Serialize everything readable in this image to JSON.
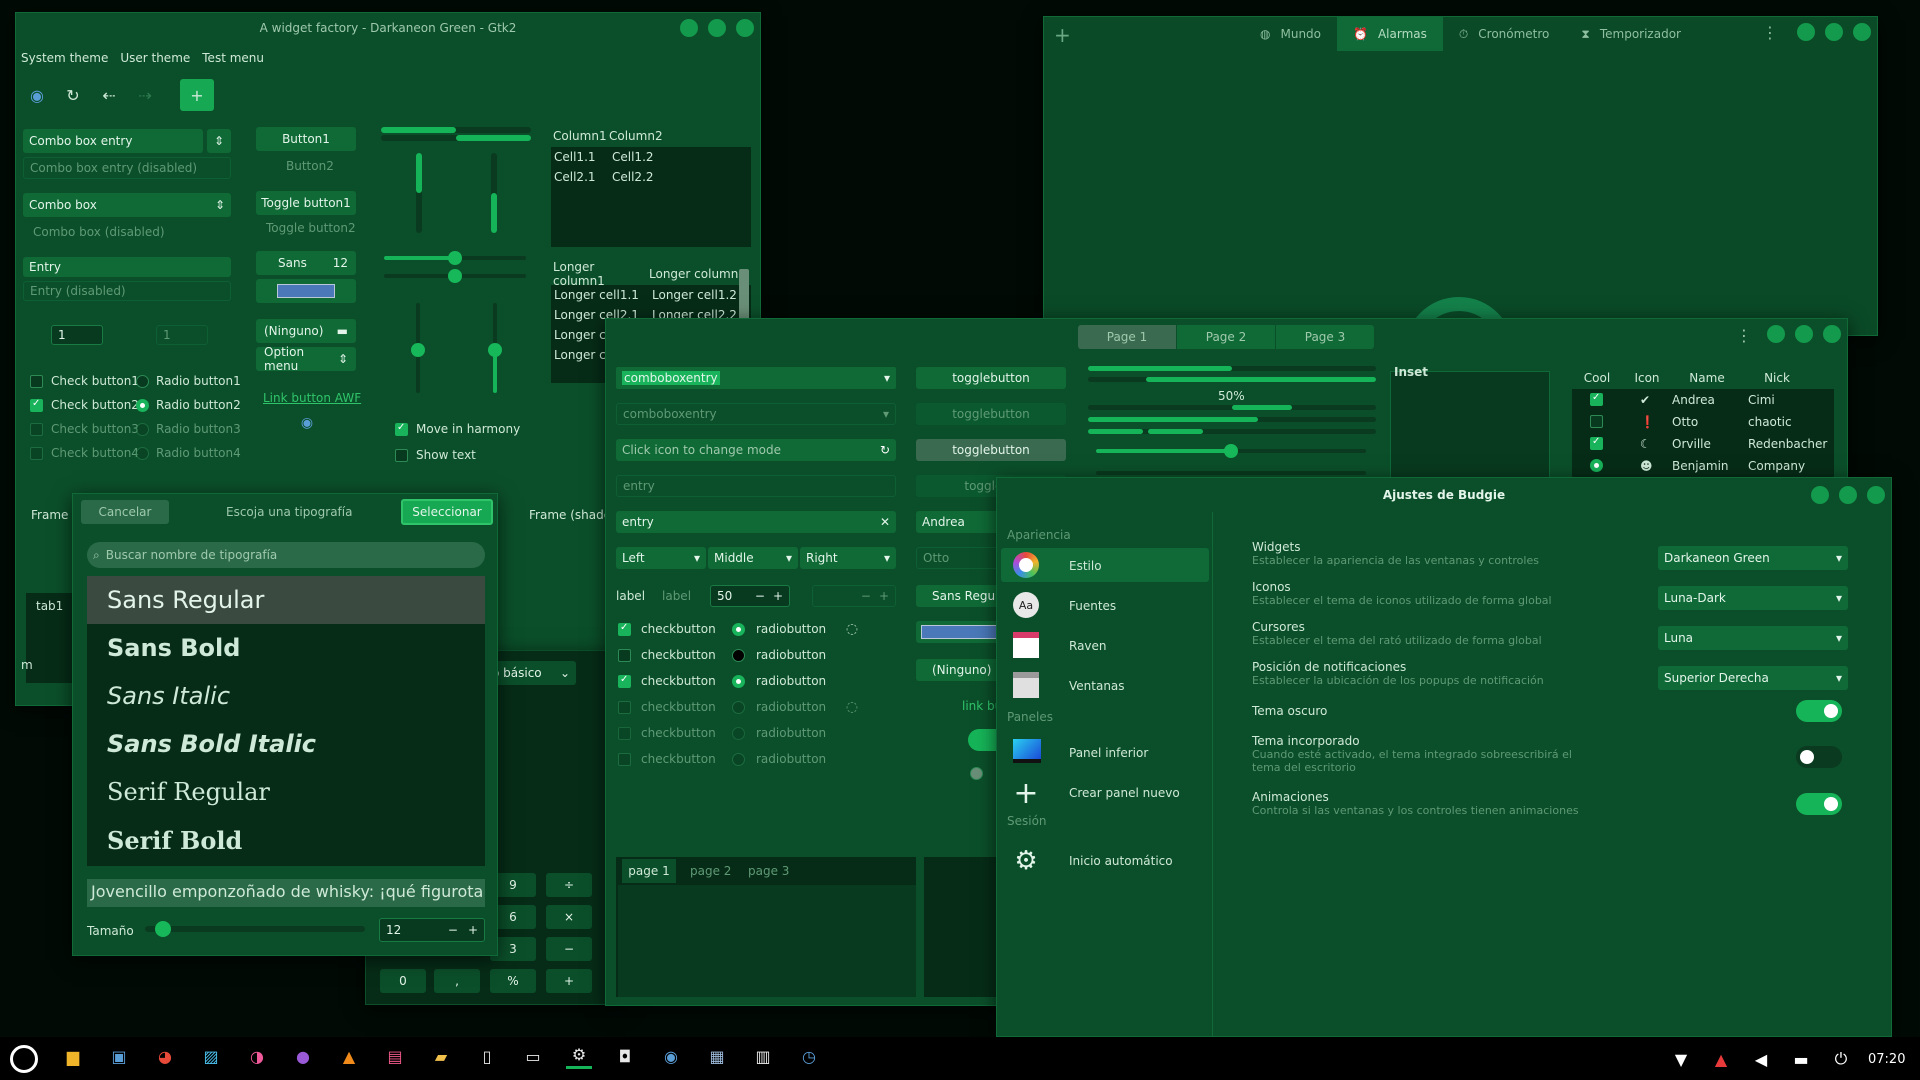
{
  "wf": {
    "title": "A widget factory - Darkaneon Green - Gtk2",
    "menu": [
      "System theme",
      "User theme",
      "Test menu"
    ],
    "combo_entry": "Combo box entry",
    "combo_entry_dis": "Combo box entry (disabled)",
    "combo": "Combo box",
    "combo_dis": "Combo box (disabled)",
    "entry": "Entry",
    "entry_dis": "Entry (disabled)",
    "spin1": "1",
    "spin2": "1",
    "checks": [
      "Check button1",
      "Check button2",
      "Check button3",
      "Check button4"
    ],
    "radios": [
      "Radio button1",
      "Radio button2",
      "Radio button3",
      "Radio button4"
    ],
    "button1": "Button1",
    "button2": "Button2",
    "toggle1": "Toggle button1",
    "toggle2": "Toggle button2",
    "font_name": "Sans",
    "font_size": "12",
    "file_btn": "(Ninguno)",
    "option_menu": "Option menu",
    "link": "Link button AWF",
    "move_harmony": "Move in harmony",
    "show_text": "Show text",
    "tree1": {
      "cols": [
        "Column1",
        "Column2"
      ],
      "rows": [
        [
          "Cell1.1",
          "Cell1.2"
        ],
        [
          "Cell2.1",
          "Cell2.2"
        ]
      ]
    },
    "tree2": {
      "cols": [
        "Longer column1",
        "Longer column"
      ],
      "rows": [
        [
          "Longer cell1.1",
          "Longer cell1.2"
        ],
        [
          "Longer cell2.1",
          "Longer cell2.2"
        ],
        [
          "Longer c",
          ""
        ],
        [
          "Longer c",
          ""
        ]
      ]
    },
    "frame1": "Frame (",
    "frame2": "Frame (shado",
    "tab1": "tab1",
    "trunc_m": "m"
  },
  "fc": {
    "cancel": "Cancelar",
    "title": "Escoja una tipografía",
    "select": "Seleccionar",
    "search_ph": "Buscar nombre de tipografía",
    "fonts": [
      "Sans Regular",
      "Sans Bold",
      "Sans Italic",
      "Sans Bold Italic",
      "Serif Regular",
      "Serif Bold"
    ],
    "preview": "Jovencillo emponzoñado de whisky: ¡qué figurota",
    "size_label": "Tamaño",
    "size": "12"
  },
  "calc": {
    "mode": "o básico",
    "keys": [
      "9",
      "÷",
      "6",
      "×",
      "3",
      "−",
      "0",
      ",",
      "%",
      "+"
    ]
  },
  "clock": {
    "tabs": [
      "Mundo",
      "Alarmas",
      "Cronómetro",
      "Temporizador"
    ]
  },
  "w3": {
    "tabs": [
      "Page 1",
      "Page 2",
      "Page 3"
    ],
    "combo1": "comboboxentry",
    "combo2": "comboboxentry",
    "icon_entry": "Click icon to change mode",
    "entry_dis": "entry",
    "entry": "entry",
    "combos3": [
      "Left",
      "Middle",
      "Right"
    ],
    "label1": "label",
    "label2": "label",
    "spin": "50",
    "checks": [
      "checkbutton",
      "checkbutton",
      "checkbutton",
      "checkbutton",
      "checkbutton",
      "checkbutton"
    ],
    "radios": [
      "radiobutton",
      "radiobutton",
      "radiobutton",
      "radiobutton",
      "radiobutton",
      "radiobutton"
    ],
    "toggles": [
      "togglebutton",
      "togglebutton",
      "togglebutton",
      "togglebu"
    ],
    "andrea": "Andrea",
    "otto": "Otto",
    "font": "Sans Regu",
    "none": "(Ninguno)",
    "link": "link bu",
    "progress": "50%",
    "inset": "Inset",
    "tree": {
      "cols": [
        "Cool",
        "Icon",
        "Name",
        "Nick"
      ],
      "rows": [
        [
          "Andrea",
          "Cimi"
        ],
        [
          "Otto",
          "chaotic"
        ],
        [
          "Orville",
          "Redenbacher"
        ],
        [
          "Benjamin",
          "Company"
        ]
      ]
    },
    "pages": [
      "page 1",
      "page 2",
      "page 3"
    ]
  },
  "bs": {
    "title": "Ajustes de Budgie",
    "sec1": "Apariencia",
    "items1": [
      "Estilo",
      "Fuentes",
      "Raven",
      "Ventanas"
    ],
    "sec2": "Paneles",
    "items2": [
      "Panel inferior",
      "Crear panel nuevo"
    ],
    "sec3": "Sesión",
    "items3": [
      "Inicio automático"
    ],
    "rows": [
      {
        "t": "Widgets",
        "d": "Establecer la apariencia de las ventanas y controles",
        "v": "Darkaneon Green"
      },
      {
        "t": "Iconos",
        "d": "Establecer el tema de iconos utilizado de forma global",
        "v": "Luna-Dark"
      },
      {
        "t": "Cursores",
        "d": "Establecer el tema del rató utilizado de forma global",
        "v": "Luna"
      },
      {
        "t": "Posición de notificaciones",
        "d": "Establecer la ubicación de los popups de notificación",
        "v": "Superior Derecha"
      }
    ],
    "tema_oscuro": "Tema oscuro",
    "tema_inc": "Tema incorporado",
    "tema_inc_d1": "Cuando esté activado, el tema integrado sobreescribirá el",
    "tema_inc_d2": "tema del escritorio",
    "anim": "Animaciones",
    "anim_d": "Controla si las ventanas y los controles tienen animaciones"
  },
  "panel": {
    "time": "07:20"
  }
}
